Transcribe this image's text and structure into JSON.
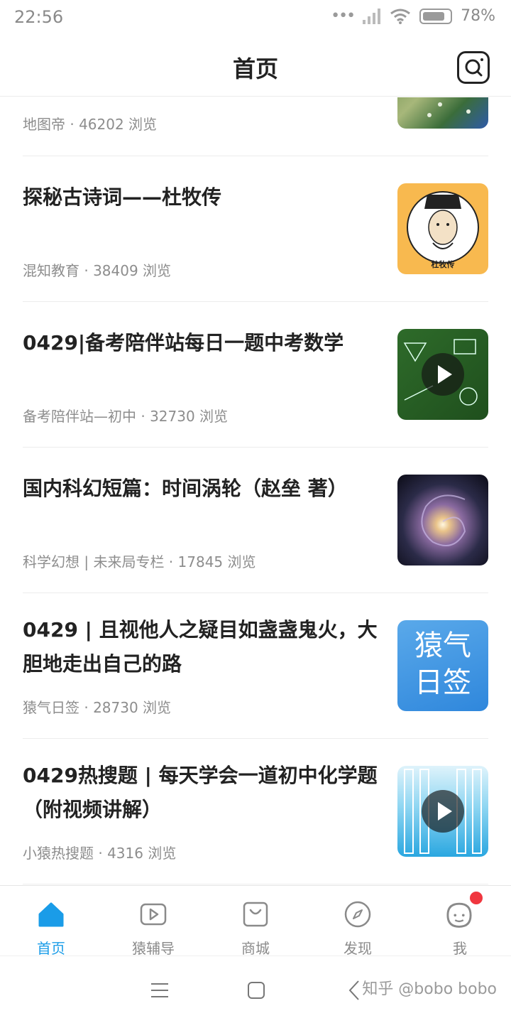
{
  "status_bar": {
    "time": "22:56",
    "battery": "78%"
  },
  "header": {
    "title": "首页"
  },
  "feed": [
    {
      "title": "",
      "meta": "地图帝 · 46202 浏览",
      "thumb": "map",
      "video": false
    },
    {
      "title": "探秘古诗词——杜牧传",
      "meta": "混知教育 · 38409 浏览",
      "thumb": "dumu",
      "thumb_caption": "杜牧传",
      "video": false
    },
    {
      "title": "0429|备考陪伴站每日一题中考数学",
      "meta": "备考陪伴站—初中 · 32730 浏览",
      "thumb": "chalkboard",
      "video": true
    },
    {
      "title": "国内科幻短篇：时间涡轮（赵垒 著）",
      "meta": "科学幻想 | 未来局专栏 · 17845 浏览",
      "thumb": "galaxy",
      "video": false
    },
    {
      "title": "0429 | 且视他人之疑目如盏盏鬼火，大胆地走出自己的路",
      "meta": "猿气日签 · 28730 浏览",
      "thumb": "yuanqi",
      "thumb_text": "猿气日签",
      "video": false
    },
    {
      "title": "0429热搜题 | 每天学会一道初中化学题（附视频讲解）",
      "meta": "小猿热搜题 · 4316 浏览",
      "thumb": "tubes",
      "video": true
    }
  ],
  "bottom_nav": {
    "items": [
      {
        "label": "首页",
        "icon": "home-icon",
        "active": true
      },
      {
        "label": "猿辅导",
        "icon": "video-play-icon",
        "active": false
      },
      {
        "label": "商城",
        "icon": "shopping-bag-icon",
        "active": false
      },
      {
        "label": "发现",
        "icon": "compass-icon",
        "active": false
      },
      {
        "label": "我",
        "icon": "profile-face-icon",
        "active": false,
        "badge": true
      }
    ]
  },
  "watermark": "知乎 @bobo bobo",
  "colors": {
    "accent": "#1a9ce8",
    "badge": "#f0363f"
  }
}
